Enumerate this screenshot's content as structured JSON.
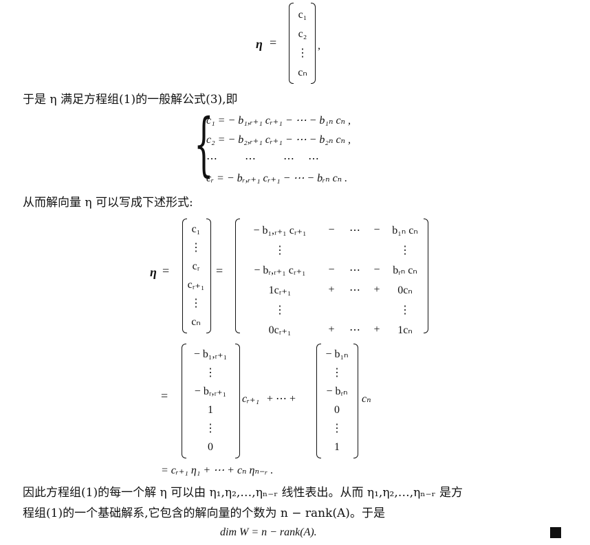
{
  "lines": {
    "l1": "于是 η 满足方程组(1)的一般解公式(3),即",
    "l2": "从而解向量 η 可以写成下述形式:",
    "l3": "因此方程组(1)的每一个解 η 可以由 η₁,η₂,…,ηₙ₋ᵣ 线性表出。从而 η₁,η₂,…,ηₙ₋ᵣ 是方",
    "l4": "程组(1)的一个基础解系,它包含的解向量的个数为 n − rank(A)。于是",
    "dimline": "dim W = n − rank(A)."
  },
  "vec_top": [
    "c₁",
    "c₂",
    "⋮",
    "cₙ"
  ],
  "system": [
    "c₁ = − b₁,ᵣ₊₁ cᵣ₊₁ − ⋯ − b₁ₙ cₙ ,",
    "c₂ = − b₂,ᵣ₊₁ cᵣ₊₁ − ⋯ − b₂ₙ cₙ ,",
    "⋯          ⋯          ⋯     ⋯",
    "cᵣ = − bᵣ,ᵣ₊₁ cᵣ₊₁ − ⋯ − bᵣₙ cₙ ."
  ],
  "big_left": [
    "c₁",
    "⋮",
    "cᵣ",
    "cᵣ₊₁",
    "⋮",
    "cₙ"
  ],
  "big_right": [
    [
      "− b₁,ᵣ₊₁ cᵣ₊₁",
      "−",
      "⋯",
      "−",
      "b₁ₙ cₙ"
    ],
    [
      "⋮",
      "",
      "",
      "",
      "⋮"
    ],
    [
      "− bᵣ,ᵣ₊₁ cᵣ₊₁",
      "−",
      "⋯",
      "−",
      "bᵣₙ cₙ"
    ],
    [
      "1cᵣ₊₁",
      "+",
      "⋯",
      "+",
      "0cₙ"
    ],
    [
      "⋮",
      "",
      "",
      "",
      "⋮"
    ],
    [
      "0cᵣ₊₁",
      "+",
      "⋯",
      "+",
      "1cₙ"
    ]
  ],
  "vec_a": [
    "− b₁,ᵣ₊₁",
    "⋮",
    "− bᵣ,ᵣ₊₁",
    "1",
    "⋮",
    "0"
  ],
  "vec_b": [
    "− b₁ₙ",
    "⋮",
    "− bᵣₙ",
    "0",
    "⋮",
    "1"
  ],
  "coef_a": "cᵣ₊₁",
  "coef_b": "cₙ",
  "mid_plus": "+ ⋯ +",
  "last_line": "= cᵣ₊₁ η₁ + ⋯ + cₙ ηₙ₋ᵣ ."
}
